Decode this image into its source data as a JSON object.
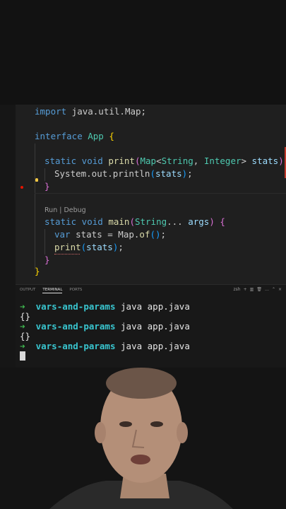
{
  "editor": {
    "lines": {
      "l1": {
        "kw": "import",
        "rest": " java.util.Map;"
      },
      "l2": {
        "kw": "interface",
        "name": " App ",
        "open": "{"
      },
      "l3": {
        "kw1": "static",
        "kw2": " void",
        "fn": " print",
        "p1": "(",
        "t1": "Map",
        "lt": "<",
        "t2": "String",
        "comma": ", ",
        "t3": "Integer",
        "gt": ">",
        "param": " stats",
        "p2": ")",
        "space": " ",
        "open": "{"
      },
      "l4": {
        "text": "System.out.println",
        "p1": "(",
        "arg": "stats",
        "p2": ")",
        "end": ";"
      },
      "l5": {
        "close": "}"
      },
      "l6": {
        "kw1": "static",
        "kw2": " void",
        "fn": " main",
        "p1": "(",
        "t1": "String",
        "dots": "...",
        "param": " args",
        "p2": ")",
        "space": " ",
        "open": "{"
      },
      "l7": {
        "kw": "var",
        "rest": " stats = Map.",
        "fn": "of",
        "p1": "(",
        "p2": ")",
        "end": ";"
      },
      "l8": {
        "fn": "print",
        "p1": "(",
        "arg": "stats",
        "p2": ")",
        "end": ";"
      },
      "l9": {
        "close": "}"
      },
      "l10": {
        "close": "}"
      }
    },
    "codelens": "Run | Debug"
  },
  "terminal": {
    "tabs": [
      "OUTPUT",
      "TERMINAL",
      "PORTS"
    ],
    "tools": {
      "shell": "zsh",
      "add": "+",
      "split": "▥",
      "trash": "🗑",
      "more": "…",
      "maximize": "⌃",
      "close": "×"
    },
    "prompt_arrow": "➜",
    "dir": "vars-and-params",
    "command": "java app.java",
    "output": "{}"
  },
  "colors": {
    "background": "#1f1f1f",
    "keyword": "#569cd6",
    "type": "#4ec9b0",
    "function": "#dcdcaa",
    "prompt": "#3fb950",
    "dir": "#39c5cf"
  }
}
